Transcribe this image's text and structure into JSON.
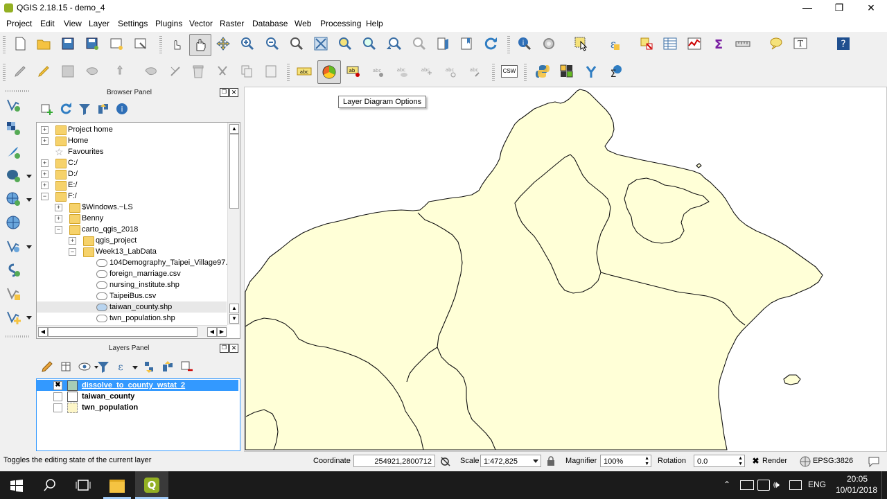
{
  "window": {
    "title": "QGIS 2.18.15 - demo_4"
  },
  "menubar": [
    "Project",
    "Edit",
    "View",
    "Layer",
    "Settings",
    "Plugins",
    "Vector",
    "Raster",
    "Database",
    "Web",
    "Processing",
    "Help"
  ],
  "tooltip": "Layer Diagram Options",
  "browser": {
    "title": "Browser Panel",
    "items": [
      {
        "label": "Project home"
      },
      {
        "label": "Home"
      },
      {
        "label": "Favourites"
      },
      {
        "label": "C:/"
      },
      {
        "label": "D:/"
      },
      {
        "label": "E:/"
      },
      {
        "label": "F:/"
      },
      {
        "label": "$Windows.~LS"
      },
      {
        "label": "Benny"
      },
      {
        "label": "carto_qgis_2018"
      },
      {
        "label": "qgis_project"
      },
      {
        "label": "Week13_LabData"
      },
      {
        "label": "104Demography_Taipei_Village97.sl"
      },
      {
        "label": "foreign_marriage.csv"
      },
      {
        "label": "nursing_institute.shp"
      },
      {
        "label": "TaipeiBus.csv"
      },
      {
        "label": "taiwan_county.shp"
      },
      {
        "label": "twn_population.shp"
      }
    ]
  },
  "layers": {
    "title": "Layers Panel",
    "items": [
      {
        "label": "dissolve_to_county_wstat_2",
        "checked": true
      },
      {
        "label": "taiwan_county",
        "checked": false
      },
      {
        "label": "twn_population",
        "checked": false
      }
    ]
  },
  "status": {
    "message": "Toggles the editing state of the current layer",
    "coordinate_label": "Coordinate",
    "coordinate": "254921,2800712",
    "scale_label": "Scale",
    "scale": "1:472,825",
    "magnifier_label": "Magnifier",
    "magnifier": "100%",
    "rotation_label": "Rotation",
    "rotation": "0.0",
    "render_label": "Render",
    "epsg": "EPSG:3826"
  },
  "toolbar": {
    "csw_label": "CSW"
  },
  "taskbar": {
    "lang": "ENG",
    "time": "20:05",
    "date": "10/01/2018"
  },
  "colors": {
    "map_fill": "#ffffd7",
    "selection": "#3399ff"
  }
}
